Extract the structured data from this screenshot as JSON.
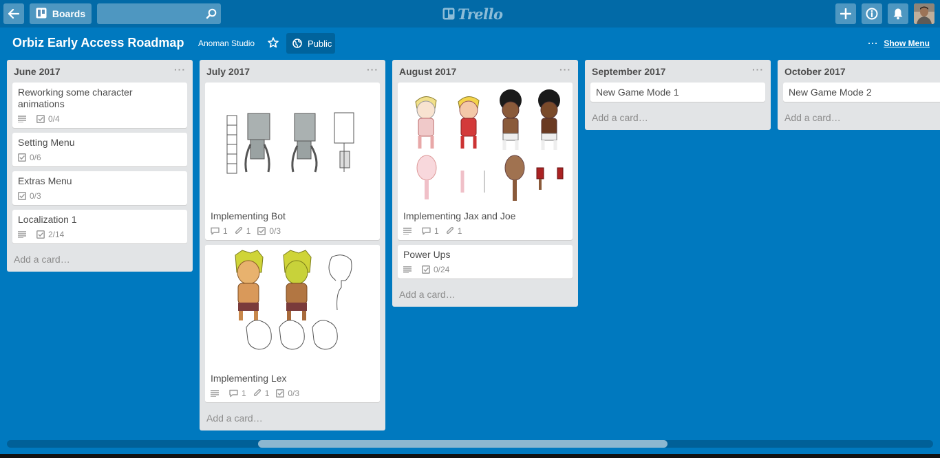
{
  "header": {
    "boards_label": "Boards",
    "logo_text": "Trello"
  },
  "board": {
    "title": "Orbiz Early Access Roadmap",
    "team": "Anoman Studio",
    "visibility": "Public",
    "show_menu": "Show Menu"
  },
  "lists": [
    {
      "title": "June 2017",
      "cards": [
        {
          "title": "Reworking some character animations",
          "checklist": "0/4"
        },
        {
          "title": "Setting Menu",
          "checklist": "0/6"
        },
        {
          "title": "Extras Menu",
          "checklist": "0/3"
        },
        {
          "title": "Localization 1",
          "checklist": "2/14"
        }
      ],
      "add_card": "Add a card…"
    },
    {
      "title": "July 2017",
      "cards": [
        {
          "title": "Implementing Bot",
          "comments": "1",
          "attachments": "1",
          "checklist": "0/3"
        },
        {
          "title": "Implementing Lex",
          "comments": "1",
          "attachments": "1",
          "checklist": "0/3"
        }
      ],
      "add_card": "Add a card…"
    },
    {
      "title": "August 2017",
      "cards": [
        {
          "title": "Implementing Jax and Joe",
          "comments": "1",
          "attachments": "1"
        },
        {
          "title": "Power Ups",
          "checklist": "0/24"
        }
      ],
      "add_card": "Add a card…"
    },
    {
      "title": "September 2017",
      "cards": [
        {
          "title": "New Game Mode 1"
        }
      ],
      "add_card": "Add a card…"
    },
    {
      "title": "October 2017",
      "cards": [
        {
          "title": "New Game Mode 2"
        }
      ],
      "add_card": "Add a card…"
    }
  ],
  "colors": {
    "board_bg": "#0079bf",
    "header_bg": "#026aa7",
    "list_bg": "#e2e4e6"
  }
}
